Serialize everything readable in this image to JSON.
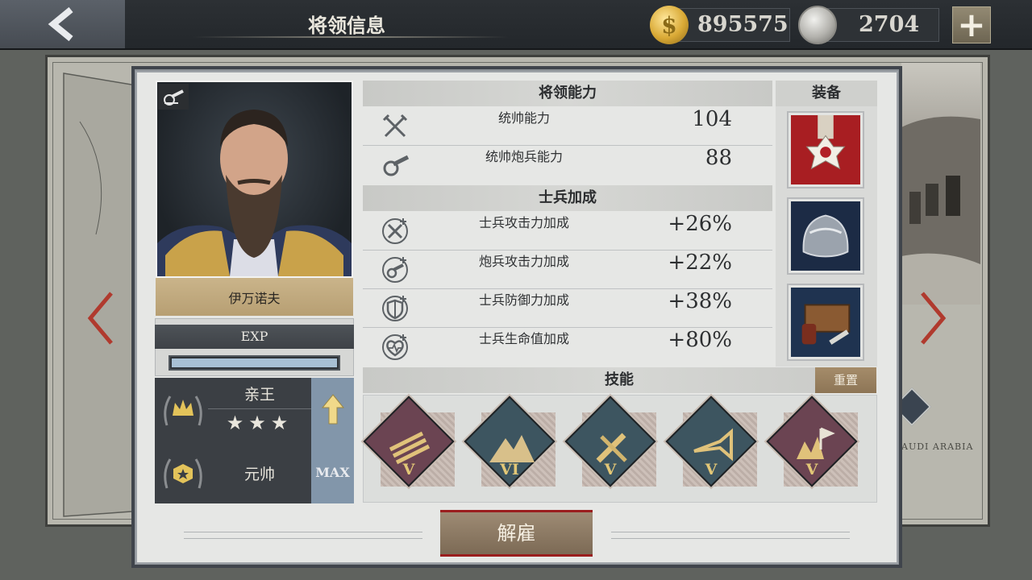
{
  "header": {
    "title": "将领信息",
    "coins": "895575",
    "medals": "2704"
  },
  "general": {
    "name": "伊万诺夫",
    "exp_label": "EXP",
    "exp_progress": 1.0,
    "rank": "亲王",
    "rank_stars": 3,
    "title_rank": "元帅",
    "title_max": "MAX"
  },
  "abilities": {
    "heading": "将领能力",
    "items": [
      {
        "label": "统帅能力",
        "value": "104"
      },
      {
        "label": "统帅炮兵能力",
        "value": "88"
      }
    ]
  },
  "bonuses": {
    "heading": "士兵加成",
    "items": [
      {
        "label": "士兵攻击力加成",
        "value": "+26%"
      },
      {
        "label": "炮兵攻击力加成",
        "value": "+22%"
      },
      {
        "label": "士兵防御力加成",
        "value": "+38%"
      },
      {
        "label": "士兵生命值加成",
        "value": "+80%"
      }
    ]
  },
  "equipment": {
    "heading": "装备",
    "items": [
      "medal-icon",
      "helmet-icon",
      "supply-box-icon"
    ]
  },
  "skills": {
    "heading": "技能",
    "reset_label": "重置",
    "items": [
      {
        "icon": "rockets-icon",
        "level": "V",
        "color": "#6b4452"
      },
      {
        "icon": "mountains-icon",
        "level": "VI",
        "color": "#3d5560"
      },
      {
        "icon": "tools-icon",
        "level": "V",
        "color": "#3d5560"
      },
      {
        "icon": "bugle-icon",
        "level": "V",
        "color": "#3d5560"
      },
      {
        "icon": "explosion-flag-icon",
        "level": "V",
        "color": "#6b4452"
      }
    ]
  },
  "dismiss_label": "解雇",
  "map": {
    "label": "AUDI ARABIA"
  }
}
